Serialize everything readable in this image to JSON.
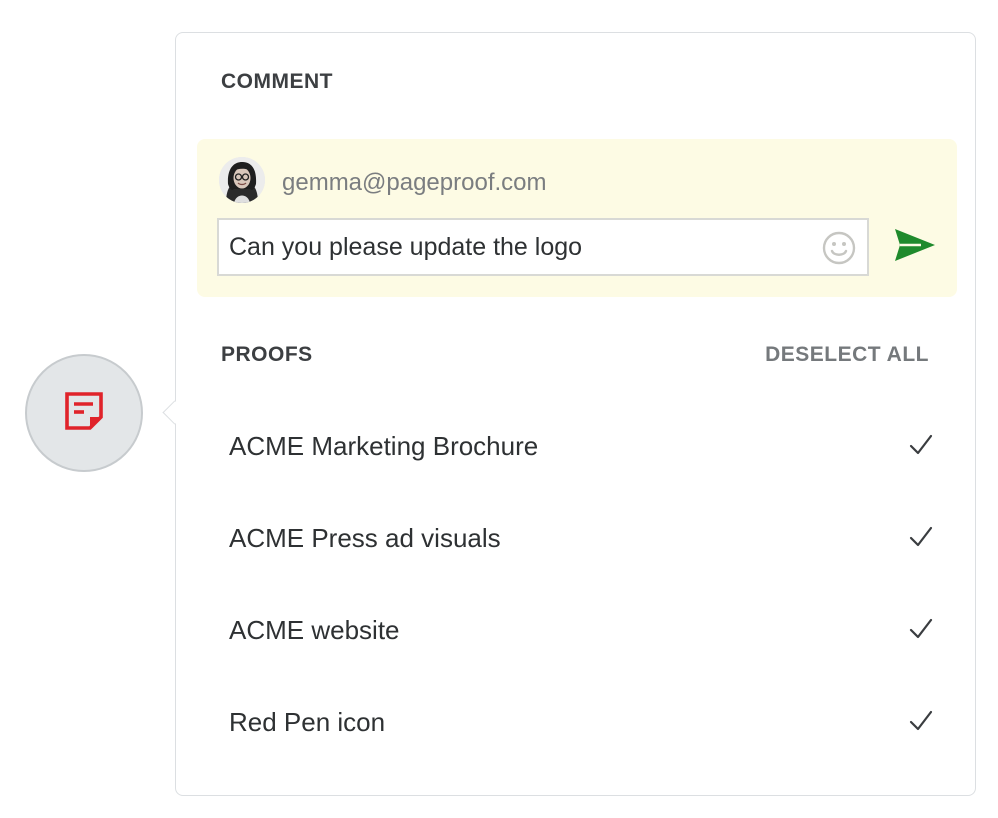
{
  "comment": {
    "title": "COMMENT",
    "author_email": "gemma@pageproof.com",
    "text": "Can you please update the logo",
    "emoji_icon": "smiley-icon",
    "send_icon": "send-arrow-icon"
  },
  "proofs": {
    "title": "PROOFS",
    "deselect_label": "DESELECT ALL",
    "items": [
      {
        "label": "ACME Marketing Brochure",
        "selected": true
      },
      {
        "label": "ACME Press ad visuals",
        "selected": true
      },
      {
        "label": "ACME website",
        "selected": true
      },
      {
        "label": "Red Pen icon",
        "selected": true
      }
    ]
  },
  "type_icon": "comment-note-icon",
  "colors": {
    "accent_red": "#e0232a",
    "send_green": "#1f8a2c",
    "comment_bg": "#fdfbe4"
  }
}
